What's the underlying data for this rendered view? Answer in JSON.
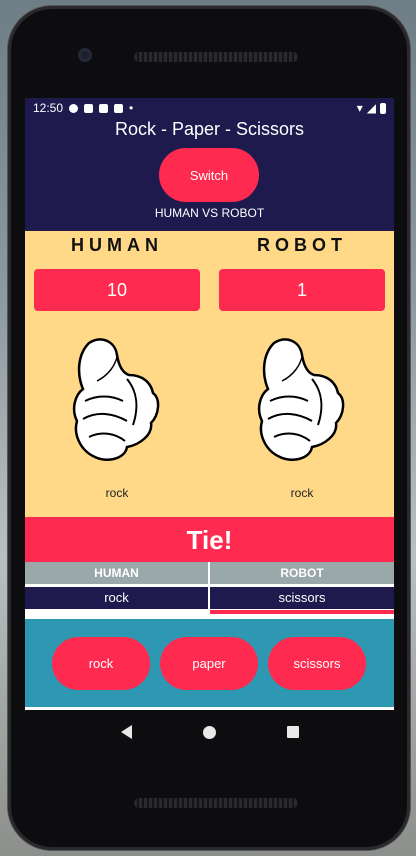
{
  "status": {
    "time": "12:50"
  },
  "app": {
    "title": "Rock - Paper - Scissors",
    "switch_label": "Switch",
    "mode": "HUMAN VS ROBOT"
  },
  "players": {
    "left": {
      "name": "HUMAN",
      "score": "10",
      "choice": "rock"
    },
    "right": {
      "name": "ROBOT",
      "score": "1",
      "choice": "rock"
    }
  },
  "result": "Tie!",
  "history": {
    "headers": [
      "HUMAN",
      "ROBOT"
    ],
    "row": [
      "rock",
      "scissors"
    ]
  },
  "choices": [
    "rock",
    "paper",
    "scissors"
  ],
  "colors": {
    "primary": "#1e1a4d",
    "accent": "#ff2a4f",
    "panel": "#ffd888",
    "footer": "#2e98b2"
  }
}
